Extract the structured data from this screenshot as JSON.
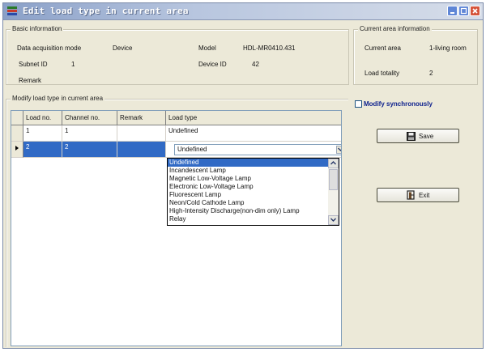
{
  "window": {
    "title": "Edit load type in current area"
  },
  "basic_info": {
    "legend": "Basic information",
    "data_acq_label": "Data acquisition mode",
    "data_acq_value": "Device",
    "model_label": "Model",
    "model_value": "HDL-MR0410.431",
    "subnet_label": "Subnet ID",
    "subnet_value": "1",
    "device_label": "Device ID",
    "device_value": "42",
    "remark_label": "Remark"
  },
  "area_info": {
    "legend": "Current area information",
    "area_label": "Current area",
    "area_value": "1-living room",
    "load_total_label": "Load totality",
    "load_total_value": "2"
  },
  "modify_group": {
    "legend": "Modify load type in current area"
  },
  "table": {
    "columns": [
      "Load no.",
      "Channel no.",
      "Remark",
      "Load type"
    ],
    "rows": [
      {
        "load_no": "1",
        "channel_no": "1",
        "remark": "",
        "load_type": "Undefined"
      },
      {
        "load_no": "2",
        "channel_no": "2",
        "remark": "",
        "load_type": "Undefined"
      }
    ]
  },
  "dropdown": {
    "options": [
      "Undefined",
      "Incandescent Lamp",
      "Magnetic Low-Voltage Lamp",
      "Electronic Low-Voltage Lamp",
      "Fluorescent Lamp",
      "Neon/Cold Cathode Lamp",
      "High-Intensity Discharge(non-dim only) Lamp",
      "Relay"
    ],
    "highlighted": "Undefined"
  },
  "modify_sync": {
    "label": "Modify synchronously",
    "checked": false
  },
  "buttons": {
    "save": "Save",
    "exit": "Exit"
  },
  "icons": {
    "app": "app-icon",
    "save": "floppy-disk-icon",
    "exit": "exit-door-icon",
    "dropdown": "chevron-down-icon"
  },
  "colors": {
    "selection": "#316ac5",
    "title_gradient_start": "#8aa0c8",
    "close_button": "#d5553c"
  }
}
